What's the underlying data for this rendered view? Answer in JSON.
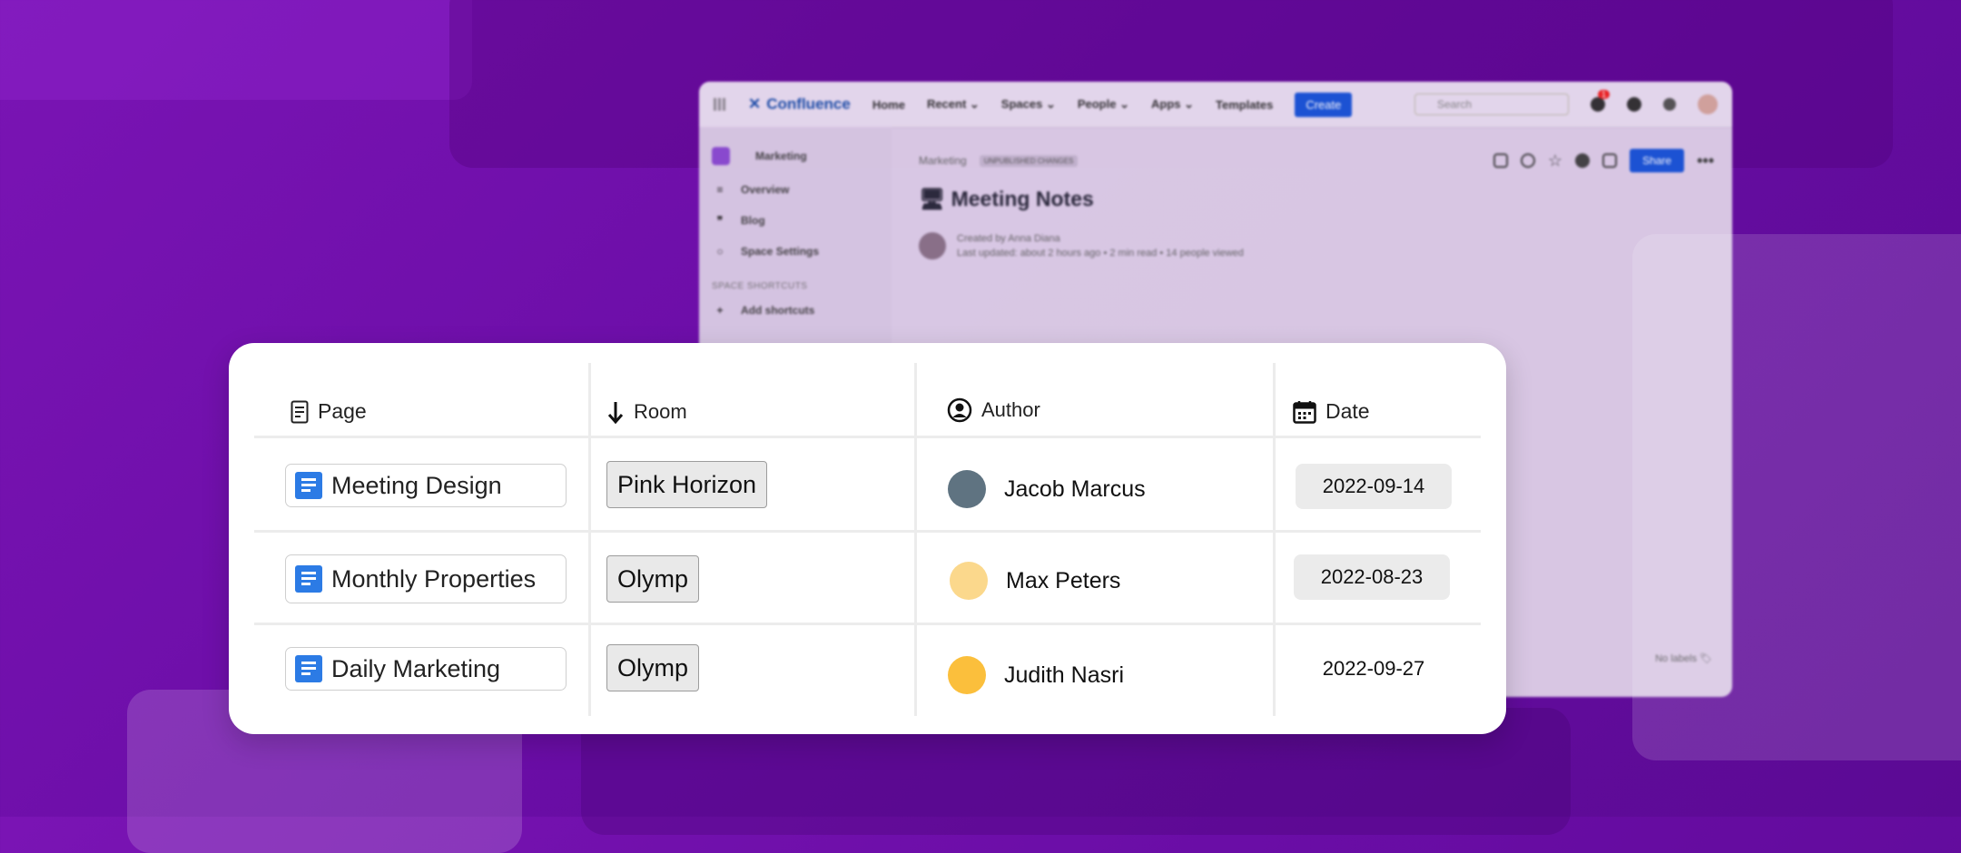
{
  "colors": {
    "bg_purple": "#6a0da6",
    "doc_blue": "#2c7be5",
    "avatar_1": "#5f7381",
    "avatar_2": "#fbd88c",
    "avatar_3": "#fbbf3c",
    "create_blue": "#1a55d6"
  },
  "confluence": {
    "logo": "Confluence",
    "nav": [
      "Home",
      "Recent ⌄",
      "Spaces ⌄",
      "People ⌄",
      "Apps ⌄",
      "Templates"
    ],
    "create_label": "Create",
    "search_placeholder": "Search",
    "notif_count": "1",
    "sidebar": {
      "space": "Marketing",
      "items": [
        {
          "icon": "overview-icon",
          "label": "Overview"
        },
        {
          "icon": "blog-icon",
          "label": "Blog"
        },
        {
          "icon": "settings-icon",
          "label": "Space Settings"
        }
      ],
      "shortcuts_title": "SPACE SHORTCUTS",
      "add_shortcuts": "Add shortcuts"
    },
    "breadcrumb": "Marketing",
    "status_pill": "UNPUBLISHED CHANGES",
    "share_label": "Share",
    "page_title": "Meeting Notes",
    "created_by": "Created by Anna Diana",
    "last_updated": "Last updated: about 2 hours ago • 2 min read • 14 people viewed",
    "no_labels": "No labels"
  },
  "table": {
    "headers": {
      "page": "Page",
      "room": "Room",
      "author": "Author",
      "date": "Date"
    },
    "rows": [
      {
        "page": "Meeting Design",
        "room": "Pink Horizon",
        "author": "Jacob Marcus",
        "date": "2022-09-14"
      },
      {
        "page": "Monthly Properties",
        "room": "Olymp",
        "author": "Max Peters",
        "date": "2022-08-23"
      },
      {
        "page": "Daily Marketing",
        "room": "Olymp",
        "author": "Judith Nasri",
        "date": "2022-09-27"
      }
    ]
  }
}
